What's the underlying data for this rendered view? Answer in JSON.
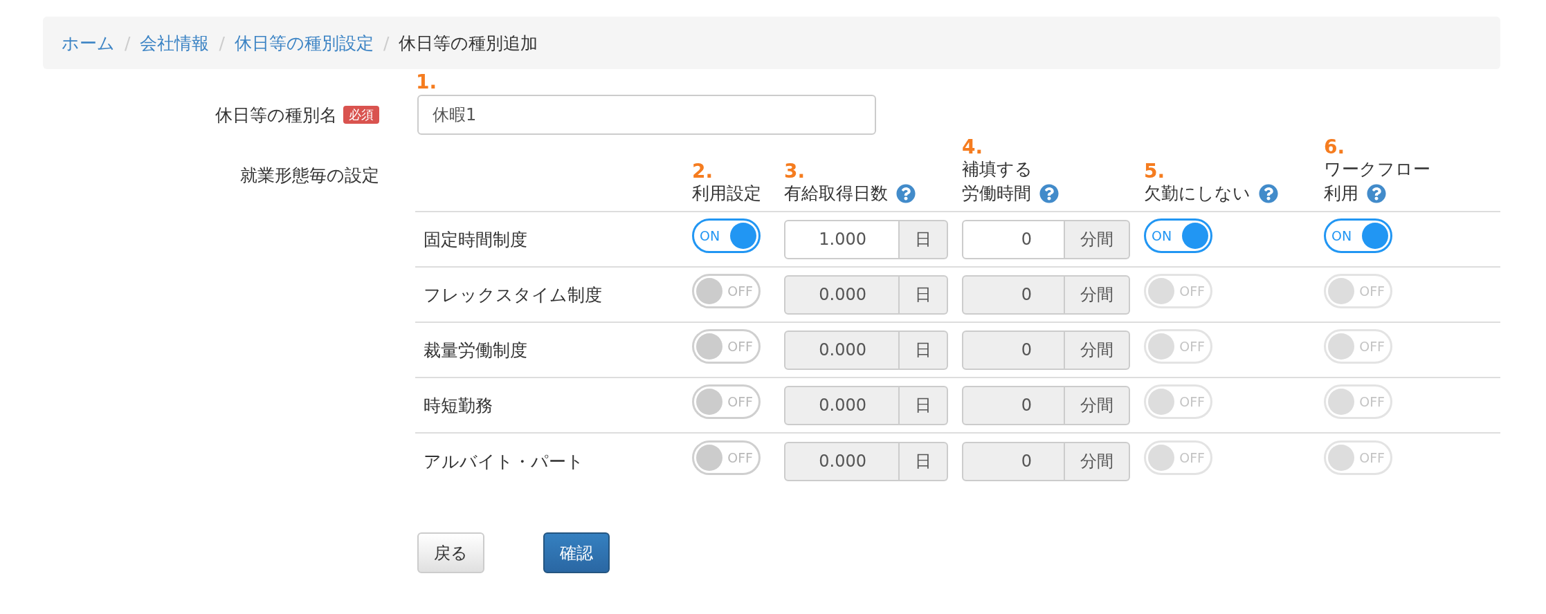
{
  "breadcrumb": [
    {
      "label": "ホーム",
      "current": false
    },
    {
      "separator": "/",
      "label": "会社情報",
      "current": false
    },
    {
      "separator": "/",
      "label": "休日等の種別設定",
      "current": false
    },
    {
      "separator": "/",
      "label": "休日等の種別追加",
      "current": true
    }
  ],
  "name_field": {
    "marker": "1.",
    "label": "休日等の種別名",
    "required_badge": "必須",
    "value": "休暇1"
  },
  "settings": {
    "label": "就業形態毎の設定",
    "columns": [
      {
        "marker": "2.",
        "lines": [
          "利用設定"
        ],
        "help": false
      },
      {
        "marker": "3.",
        "lines": [
          "有給取得日数"
        ],
        "help": true
      },
      {
        "marker": "4.",
        "lines": [
          "補填する",
          "労働時間"
        ],
        "help": true
      },
      {
        "marker": "5.",
        "lines": [
          "欠勤にしない"
        ],
        "help": true
      },
      {
        "marker": "6.",
        "lines": [
          "ワークフロー",
          "利用"
        ],
        "help": true
      }
    ],
    "rows": [
      {
        "name": "固定時間制度",
        "cells": [
          {
            "kind": "toggle",
            "on": true,
            "disabled": false,
            "label": "ON"
          },
          {
            "kind": "number",
            "value": "1.000",
            "unit": "日",
            "disabled": false
          },
          {
            "kind": "number",
            "value": "0",
            "unit": "分間",
            "disabled": false
          },
          {
            "kind": "toggle",
            "on": true,
            "disabled": false,
            "label": "ON"
          },
          {
            "kind": "toggle",
            "on": true,
            "disabled": false,
            "label": "ON"
          }
        ]
      },
      {
        "name": "フレックスタイム制度",
        "cells": [
          {
            "kind": "toggle",
            "on": false,
            "disabled": false,
            "label": "OFF"
          },
          {
            "kind": "number",
            "value": "0.000",
            "unit": "日",
            "disabled": true
          },
          {
            "kind": "number",
            "value": "0",
            "unit": "分間",
            "disabled": true
          },
          {
            "kind": "toggle",
            "on": false,
            "disabled": true,
            "label": "OFF"
          },
          {
            "kind": "toggle",
            "on": false,
            "disabled": true,
            "label": "OFF"
          }
        ]
      },
      {
        "name": "裁量労働制度",
        "cells": [
          {
            "kind": "toggle",
            "on": false,
            "disabled": false,
            "label": "OFF"
          },
          {
            "kind": "number",
            "value": "0.000",
            "unit": "日",
            "disabled": true
          },
          {
            "kind": "number",
            "value": "0",
            "unit": "分間",
            "disabled": true
          },
          {
            "kind": "toggle",
            "on": false,
            "disabled": true,
            "label": "OFF"
          },
          {
            "kind": "toggle",
            "on": false,
            "disabled": true,
            "label": "OFF"
          }
        ]
      },
      {
        "name": "時短勤務",
        "cells": [
          {
            "kind": "toggle",
            "on": false,
            "disabled": false,
            "label": "OFF"
          },
          {
            "kind": "number",
            "value": "0.000",
            "unit": "日",
            "disabled": true
          },
          {
            "kind": "number",
            "value": "0",
            "unit": "分間",
            "disabled": true
          },
          {
            "kind": "toggle",
            "on": false,
            "disabled": true,
            "label": "OFF"
          },
          {
            "kind": "toggle",
            "on": false,
            "disabled": true,
            "label": "OFF"
          }
        ]
      },
      {
        "name": "アルバイト・パート",
        "cells": [
          {
            "kind": "toggle",
            "on": false,
            "disabled": false,
            "label": "OFF"
          },
          {
            "kind": "number",
            "value": "0.000",
            "unit": "日",
            "disabled": true
          },
          {
            "kind": "number",
            "value": "0",
            "unit": "分間",
            "disabled": true
          },
          {
            "kind": "toggle",
            "on": false,
            "disabled": true,
            "label": "OFF"
          },
          {
            "kind": "toggle",
            "on": false,
            "disabled": true,
            "label": "OFF"
          }
        ]
      }
    ]
  },
  "buttons": [
    {
      "label": "戻る",
      "kind": "default"
    },
    {
      "label": "確認",
      "kind": "primary"
    }
  ]
}
